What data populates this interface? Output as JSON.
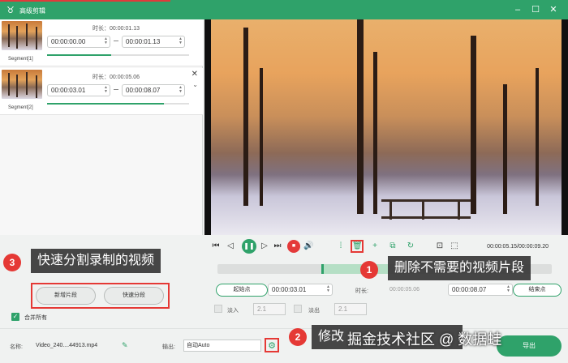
{
  "window": {
    "title": "高级剪辑"
  },
  "segments": [
    {
      "name": "Segment[1]",
      "duration_label": "时长：00:00:01.13",
      "start": "00:00:00.00",
      "end": "00:00:01.13",
      "progress": 0.45,
      "selected": true
    },
    {
      "name": "Segment[2]",
      "duration_label": "时长：00:00:05.06",
      "start": "00:00:03.01",
      "end": "00:00:08.07",
      "progress": 0.82,
      "selected": false
    }
  ],
  "player": {
    "timecode": "00:00:05.15/00:00:09.20"
  },
  "timeline": {
    "selection_start": 0.31,
    "selection_end": 0.51
  },
  "range": {
    "start_btn": "起始点",
    "start_value": "00:00:03.01",
    "duration_label": "时长:",
    "duration_value": "00:00:05.06",
    "end_value": "00:00:08.07",
    "end_btn": "结束点"
  },
  "fade": {
    "in_label": "淡入",
    "in_value": "2.1",
    "out_label": "淡出",
    "out_value": "2.1"
  },
  "left_actions": {
    "new_segment": "新增片段",
    "quick_split": "快速分段",
    "merge_all": "合并所有"
  },
  "bottom": {
    "name_label": "名称:",
    "filename": "Video_240....44913.mp4",
    "output_label": "输出:",
    "output_value": "自动Auto",
    "export": "导出"
  },
  "callouts": [
    {
      "num": "1",
      "text": "删除不需要的视频片段"
    },
    {
      "num": "2",
      "text": "修改"
    },
    {
      "num": "3",
      "text": "快速分割录制的视频"
    }
  ],
  "watermark": "掘金技术社区 @ 数据蛙",
  "colors": {
    "brand": "#2fa26a",
    "highlight": "#e53935",
    "callout_bg": "#3a3a3a"
  }
}
